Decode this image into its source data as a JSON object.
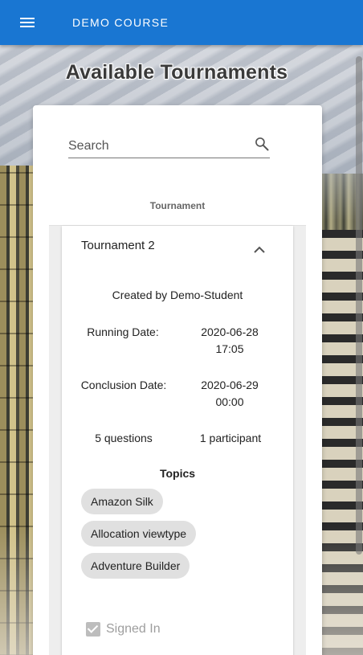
{
  "appbar": {
    "title": "DEMO COURSE",
    "menu_icon": "menu-icon",
    "color": "#1976d2"
  },
  "page": {
    "title": "Available Tournaments"
  },
  "search": {
    "placeholder": "Search",
    "value": "",
    "icon": "search-icon"
  },
  "table": {
    "column_header": "Tournament"
  },
  "tournament": {
    "name": "Tournament 2",
    "expanded_icon": "chevron-up-icon",
    "created_by": "Created by Demo-Student",
    "running_date_label": "Running Date:",
    "running_date": "2020-06-28",
    "running_time": "17:05",
    "conclusion_date_label": "Conclusion Date:",
    "conclusion_date": "2020-06-29",
    "conclusion_time": "00:00",
    "questions": "5 questions",
    "participants": "1 participant",
    "topics_label": "Topics",
    "topics": [
      "Amazon Silk",
      "Allocation viewtype",
      "Adventure Builder"
    ],
    "signed_in_label": "Signed In",
    "signed_in": true
  }
}
